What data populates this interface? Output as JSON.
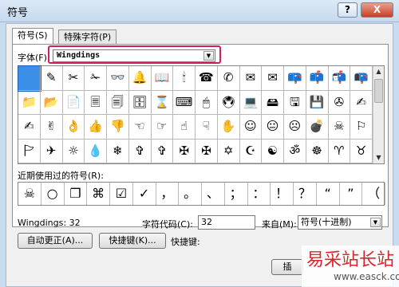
{
  "window": {
    "title": "符号",
    "help_label": "?",
    "close_label": "X"
  },
  "tabs": [
    {
      "label": "符号(S)",
      "active": true
    },
    {
      "label": "特殊字符(P)",
      "active": false
    }
  ],
  "font": {
    "label": "字体(F):",
    "value": "Wingdings"
  },
  "symbols": [
    "",
    "✎",
    "✂",
    "✁",
    "👓",
    "🔔",
    "📖",
    "🕯",
    "☎",
    "✆",
    "✉",
    "✉",
    "📪",
    "📫",
    "📬",
    "📭",
    "📁",
    "📂",
    "📄",
    "🗏",
    "🗐",
    "🗄",
    "⌛",
    "⌨",
    "🖱",
    "🖲",
    "💻",
    "🖴",
    "🖫",
    "💾",
    "✇",
    "✍",
    "✍",
    "✌",
    "👌",
    "👍",
    "👎",
    "☜",
    "☞",
    "☝",
    "☟",
    "✋",
    "☺",
    "😐",
    "☹",
    "💣",
    "☠",
    "⚐",
    "🏱",
    "✈",
    "☼",
    "💧",
    "❄",
    "✞",
    "✞",
    "✠",
    "✠",
    "✡",
    "☪",
    "☯",
    "ॐ",
    "☸",
    "♈",
    "♉"
  ],
  "recent": {
    "label": "近期使用过的符号(R):",
    "symbols": [
      "☠",
      "○",
      "❐",
      "⌘",
      "☑",
      "✓",
      "，",
      "。",
      "、",
      "；",
      "：",
      "！",
      "？",
      "“",
      "”",
      "（"
    ]
  },
  "status": {
    "font_code": "Wingdings: 32"
  },
  "char_code": {
    "label": "字符代码(C):",
    "value": "32"
  },
  "from": {
    "label": "来自(M):",
    "value": "符号(十进制)"
  },
  "buttons": {
    "autocorrect": "自动更正(A)...",
    "shortcut": "快捷键(K)...",
    "shortcut_label": "快捷键:",
    "insert_partial": "插"
  },
  "watermark": {
    "main": "易采站长站",
    "sub": "www.easck.com"
  }
}
